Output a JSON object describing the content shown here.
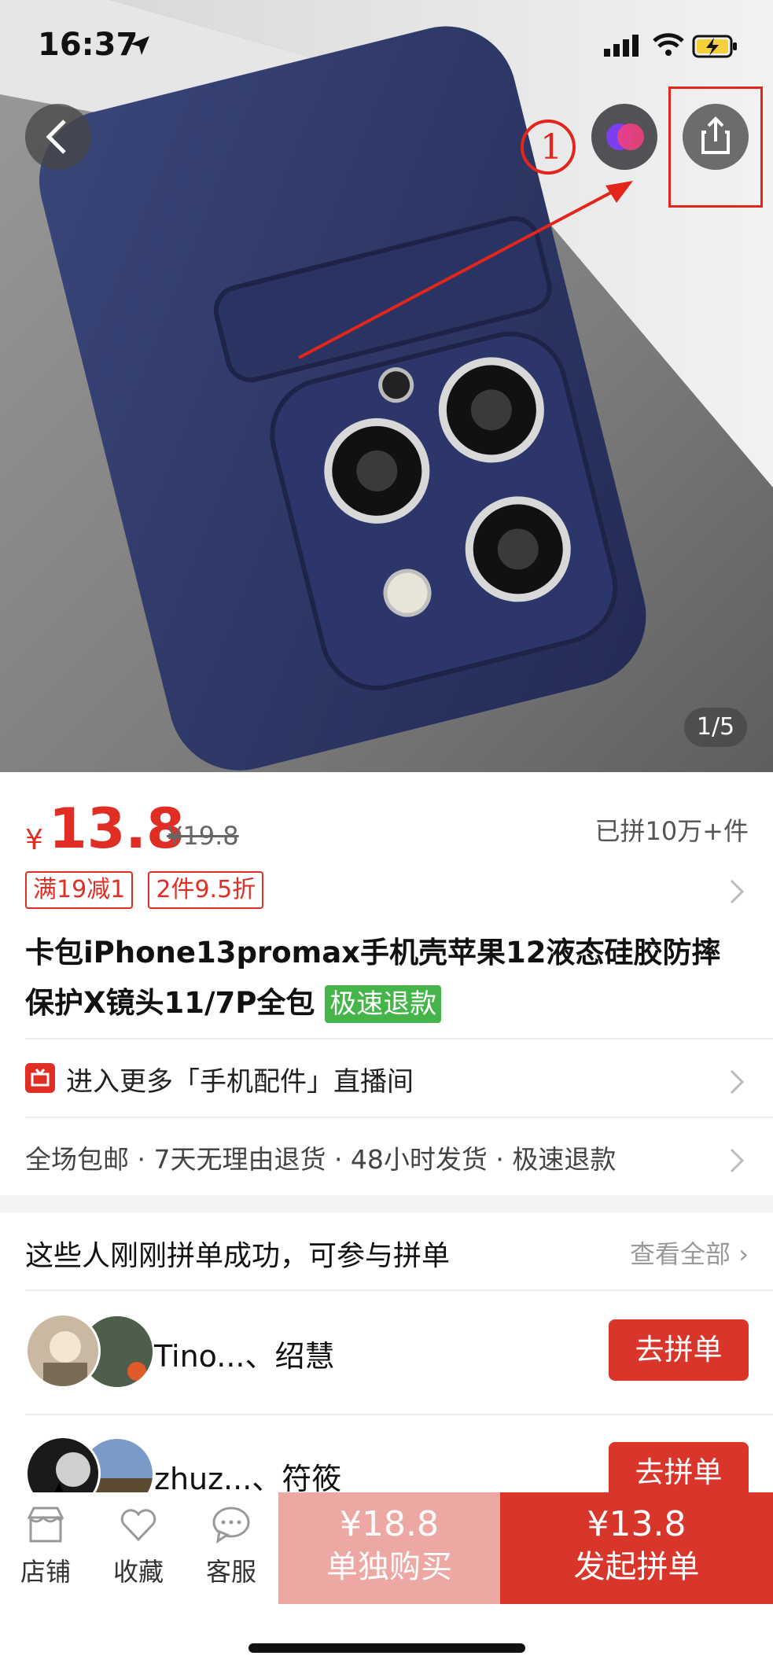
{
  "status_bar": {
    "time": "16:37"
  },
  "gallery": {
    "pager": "1/5",
    "annotation_number": "①"
  },
  "product": {
    "currency": "¥",
    "price": "13.8",
    "original_price": "¥19.8",
    "sold": "已拼10万+件",
    "promo_tags": [
      "满19减1",
      "2件9.5折"
    ],
    "title": "卡包iPhone13promax手机壳苹果12液态硅胶防摔保护X镜头11/7P全包",
    "title_badge": "极速退款"
  },
  "live": {
    "text": "进入更多「手机配件」直播间"
  },
  "services": {
    "text": "全场包邮 · 7天无理由退货 · 48小时发货 · 极速退款"
  },
  "group_buy": {
    "title": "这些人刚刚拼单成功，可参与拼单",
    "view_all": "查看全部",
    "members": [
      {
        "name": "Tino...、绍慧",
        "button": "去拼单"
      },
      {
        "name": "zhuz...、符筱",
        "button": "去拼单"
      }
    ]
  },
  "bottom_bar": {
    "store": "店铺",
    "favorite": "收藏",
    "service": "客服",
    "buy_alone": {
      "price": "¥18.8",
      "label": "单独购买"
    },
    "buy_group": {
      "price": "¥13.8",
      "label": "发起拼单"
    }
  },
  "colors": {
    "accent": "#e02e24",
    "badge_green": "#45b549",
    "case_navy": "#2b3567"
  }
}
